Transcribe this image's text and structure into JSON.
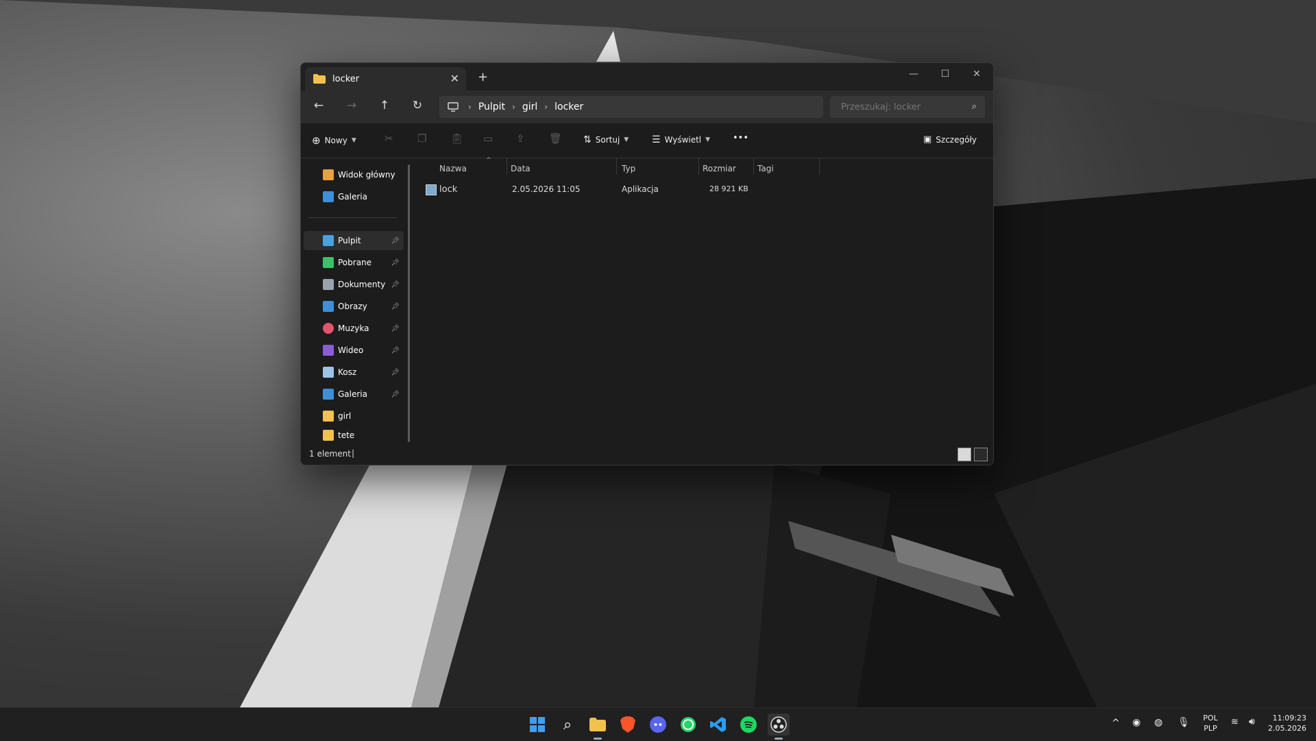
{
  "window": {
    "tab_title": "locker",
    "new_tab": "+",
    "close_tab": "✕",
    "minimize": "—",
    "maximize": "☐",
    "close": "✕"
  },
  "breadcrumb": [
    "Pulpit",
    "girl",
    "locker"
  ],
  "search": {
    "placeholder": "Przeszukaj: locker"
  },
  "toolbar": {
    "new_label": "Nowy",
    "sort_label": "Sortuj",
    "view_label": "Wyświetl",
    "more_label": "•••",
    "details_label": "Szczegóły"
  },
  "sidebar": {
    "top": [
      {
        "label": "Widok główny",
        "icon": "home-icon",
        "color": "#e8a040"
      },
      {
        "label": "Galeria",
        "icon": "gallery-icon",
        "color": "#3f8fd6"
      }
    ],
    "pinned": [
      {
        "label": "Pulpit",
        "icon": "desktop-icon",
        "color": "#4aa3e0"
      },
      {
        "label": "Pobrane",
        "icon": "download-icon",
        "color": "#3fbf6a"
      },
      {
        "label": "Dokumenty",
        "icon": "documents-icon",
        "color": "#9aa3ad"
      },
      {
        "label": "Obrazy",
        "icon": "pictures-icon",
        "color": "#3f8fd6"
      },
      {
        "label": "Muzyka",
        "icon": "music-icon",
        "color": "#e0566b"
      },
      {
        "label": "Wideo",
        "icon": "video-icon",
        "color": "#8b5cd6"
      },
      {
        "label": "Kosz",
        "icon": "recycle-bin-icon",
        "color": "#9ec3e6"
      },
      {
        "label": "Galeria",
        "icon": "gallery-icon",
        "color": "#3f8fd6"
      },
      {
        "label": "girl",
        "icon": "folder-icon",
        "color": "#f2c14e"
      },
      {
        "label": "tete",
        "icon": "folder-icon",
        "color": "#f2c14e"
      }
    ]
  },
  "table": {
    "columns": [
      "Nazwa",
      "Data",
      "Typ",
      "Rozmiar",
      "Tagi"
    ],
    "rows": [
      {
        "name": "lock",
        "date": "2.05.2026 11:05",
        "type": "Aplikacja",
        "size": "28 921 KB"
      }
    ]
  },
  "status": {
    "count": "1 element"
  },
  "tray": {
    "language": "POL",
    "layout": "PLP",
    "time": "11:09:23",
    "date": "2.05.2026"
  }
}
